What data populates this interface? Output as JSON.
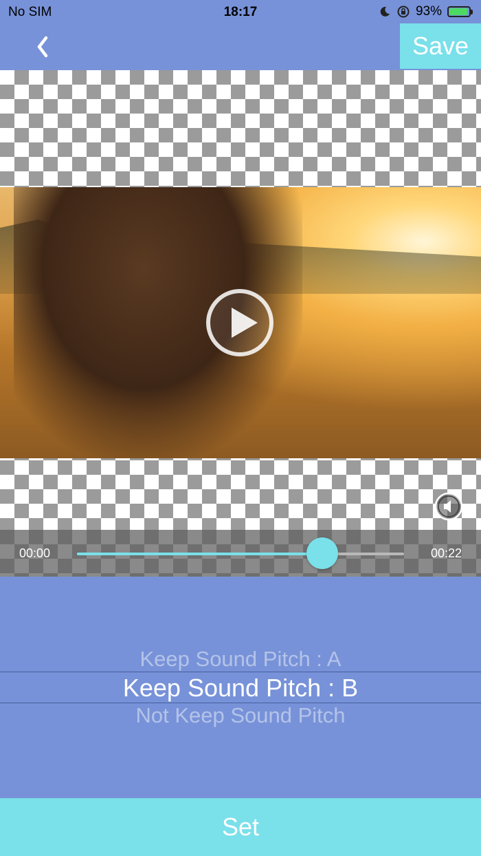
{
  "status_bar": {
    "carrier": "No SIM",
    "time": "18:17",
    "battery_percent": "93%",
    "battery_level": 0.93
  },
  "header": {
    "back_icon": "chevron-left-icon",
    "save_label": "Save"
  },
  "player": {
    "current_time": "00:00",
    "duration": "00:22",
    "progress": 0.75,
    "play_icon": "play-icon",
    "mute_icon": "speaker-muted-icon"
  },
  "pitch_picker": {
    "options": [
      "Keep Sound Pitch : A",
      "Keep Sound Pitch : B",
      "Not Keep Sound Pitch"
    ],
    "selected_index": 1
  },
  "footer": {
    "set_label": "Set"
  },
  "colors": {
    "background": "#7792d8",
    "accent": "#7ae0ea"
  }
}
